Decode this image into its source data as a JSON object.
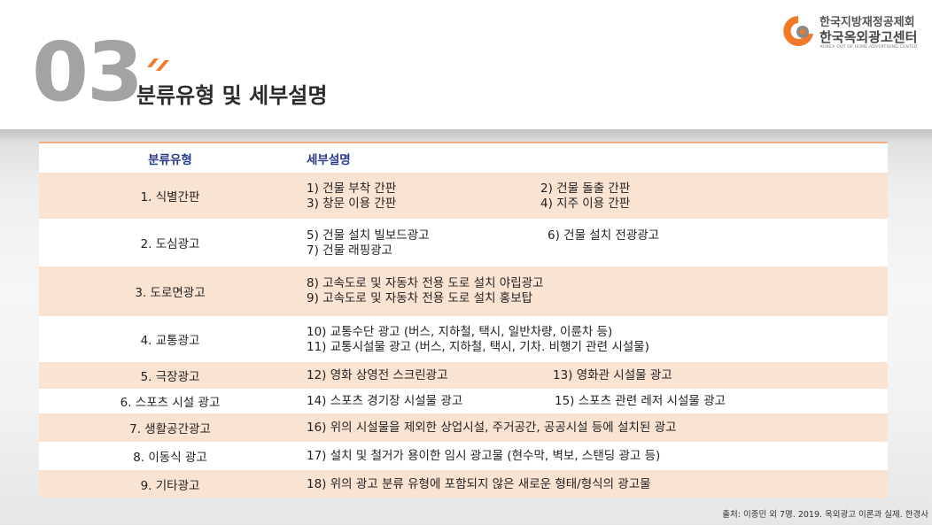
{
  "header": {
    "section_number": "03",
    "title": "분류유형 및 세부설명"
  },
  "logo": {
    "line1": "한국지방재정공제회",
    "line2": "한국옥외광고센터",
    "line3": "KOREA OUT OF HOME ADVERTISING CENTER"
  },
  "colors": {
    "accent_orange": "#f07a28",
    "header_blue": "#2a3a8c",
    "row_alt": "#fbe3d2",
    "number_gray": "#a3a3a3"
  },
  "table": {
    "headers": {
      "category": "분류유형",
      "description": "세부설명"
    },
    "rows": [
      {
        "category": "1.  식별간판",
        "lines": [
          [
            "1) 건물 부착 간판",
            "2) 건물 돌출 간판"
          ],
          [
            "3) 창문 이용 간판",
            "4) 지주 이용 간판"
          ]
        ]
      },
      {
        "category": "2. 도심광고",
        "lines": [
          [
            "5) 건물 설치 빌보드광고",
            "6) 건물 설치 전광광고"
          ],
          [
            "7) 건물 래핑광고"
          ]
        ]
      },
      {
        "category": "3. 도로면광고",
        "lines": [
          [
            "8) 고속도로 및 자동차 전용 도로 설치 야립광고"
          ],
          [
            "9) 고속도로 및 자동차 전용 도로 설치 홍보탑"
          ]
        ]
      },
      {
        "category": "4. 교통광고",
        "lines": [
          [
            "10) 교통수단 광고 (버스, 지하철, 택시, 일반차량, 이륜차 등)"
          ],
          [
            "11) 교통시설물 광고 (버스, 지하철, 택시, 기차. 비행기 관련 시설물)"
          ]
        ]
      },
      {
        "category": "5. 극장광고",
        "lines": [
          [
            "12) 영화 상영전 스크린광고",
            "13) 영화관 시설물 광고"
          ]
        ]
      },
      {
        "category": "6. 스포츠 시설 광고",
        "lines": [
          [
            "14) 스포츠 경기장 시설물 광고",
            "15) 스포츠 관련 레저 시설물 광고"
          ]
        ]
      },
      {
        "category": "7. 생활공간광고",
        "lines": [
          [
            "16) 위의 시설물을 제외한 상업시설, 주거공간, 공공시설 등에 설치된 광고"
          ]
        ]
      },
      {
        "category": "8. 이동식 광고",
        "lines": [
          [
            "17) 설치 및 철거가 용이한 임시 광고물 (현수막, 벽보, 스탠딩 광고 등)"
          ]
        ]
      },
      {
        "category": "9. 기타광고",
        "lines": [
          [
            "18) 위의 광고 분류 유형에 포함되지 않은 새로운 형태/형식의 광고물"
          ]
        ]
      }
    ]
  },
  "source": "출처: 이종민 외 7명. 2019. 옥외광고 이론과 실제. 한경사"
}
